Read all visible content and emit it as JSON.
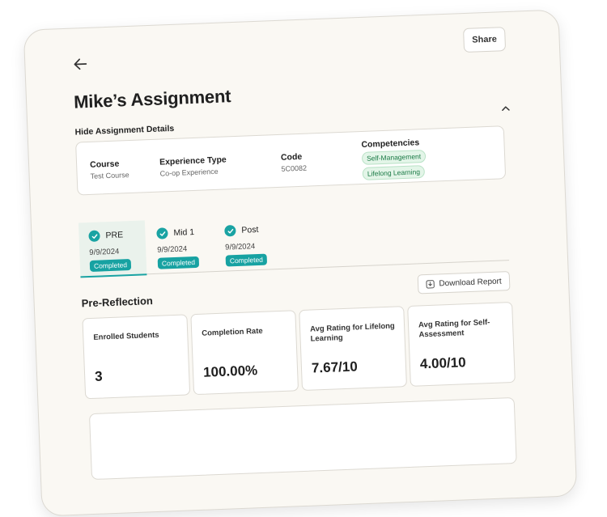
{
  "header": {
    "share_label": "Share"
  },
  "assignment": {
    "title": "Mike’s Assignment",
    "toggle_label": "Hide Assignment Details",
    "details": {
      "course_label": "Course",
      "course_value": "Test Course",
      "experience_label": "Experience Type",
      "experience_value": "Co-op Experience",
      "code_label": "Code",
      "code_value": "5C0082",
      "competencies_label": "Competencies",
      "competencies": [
        "Self-Management",
        "Lifelong Learning"
      ]
    }
  },
  "tabs": [
    {
      "name": "PRE",
      "date": "9/9/2024",
      "status": "Completed",
      "active": true
    },
    {
      "name": "Mid 1",
      "date": "9/9/2024",
      "status": "Completed",
      "active": false
    },
    {
      "name": "Post",
      "date": "9/9/2024",
      "status": "Completed",
      "active": false
    }
  ],
  "section": {
    "title": "Pre-Reflection",
    "download_label": "Download Report"
  },
  "stats": [
    {
      "label": "Enrolled Students",
      "value": "3"
    },
    {
      "label": "Completion Rate",
      "value": "100.00%"
    },
    {
      "label": "Avg Rating for Lifelong Learning",
      "value": "7.67/10"
    },
    {
      "label": "Avg Rating for Self-Assessment",
      "value": "4.00/10"
    }
  ],
  "colors": {
    "accent": "#17a2a2",
    "badge_green": "#1a7a45",
    "card_bg": "#faf8f3"
  },
  "icons": [
    "arrow-left-icon",
    "chevron-up-icon",
    "check-circle-icon",
    "download-icon"
  ]
}
